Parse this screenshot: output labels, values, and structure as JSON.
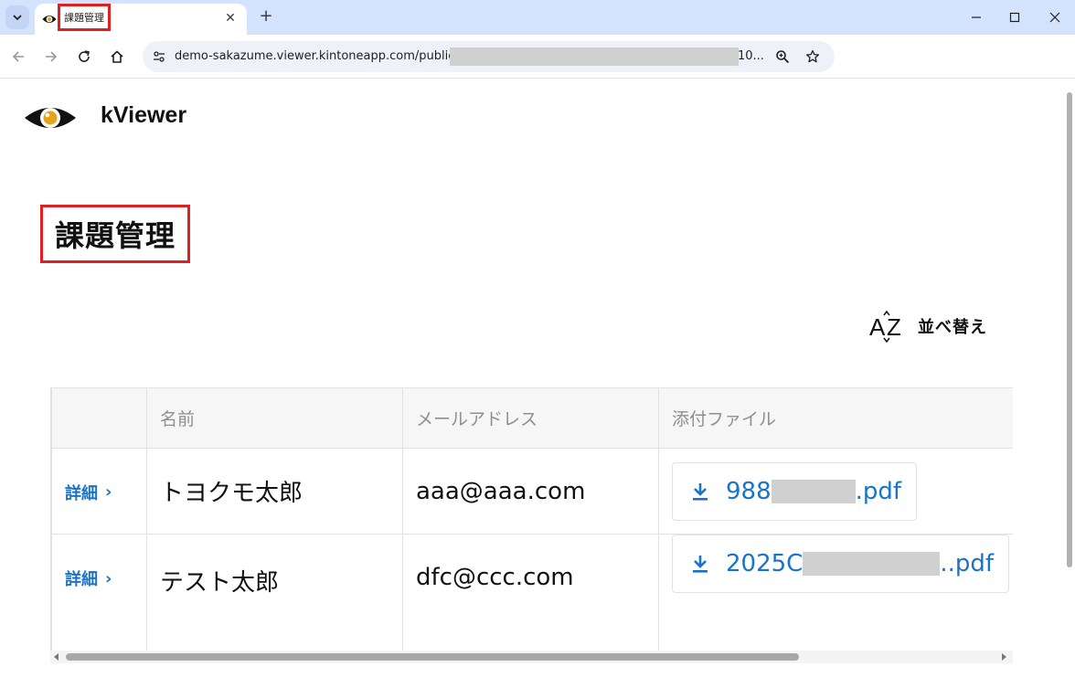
{
  "browser": {
    "tab_title": "課題管理",
    "url_prefix": "demo-sakazume.viewer.kintoneapp.com/public/c",
    "url_suffix": "10...",
    "new_tab_glyph": "+",
    "close_glyph": "✕",
    "win_minimize": "—",
    "win_restore": "☐",
    "win_close": "✕"
  },
  "app": {
    "brand": "kViewer",
    "page_title": "課題管理",
    "sort_label": "並べ替え",
    "accent_color": "#1a73c8"
  },
  "table": {
    "columns": [
      "",
      "名前",
      "メールアドレス",
      "添付ファイル"
    ],
    "detail_label": "詳細",
    "chevron": "›",
    "rows": [
      {
        "name": "トヨクモ太郎",
        "email": "aaa@aaa.com",
        "file_start": "988",
        "file_end": ".pdf"
      },
      {
        "name": "テスト太郎",
        "email": "dfc@ccc.com",
        "file_start": "2025C",
        "file_end": "..pdf"
      }
    ]
  }
}
